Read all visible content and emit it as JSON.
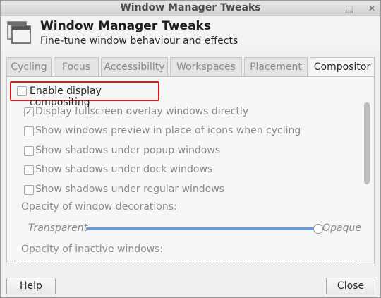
{
  "window": {
    "title": "Window Manager Tweaks",
    "controls": [
      "⬚",
      "✕"
    ]
  },
  "header": {
    "icon": "window-manager-icon",
    "title": "Window Manager Tweaks",
    "subtitle": "Fine-tune window behaviour and effects"
  },
  "tabs": [
    {
      "label": "Cycling",
      "active": false
    },
    {
      "label": "Focus",
      "active": false
    },
    {
      "label": "Accessibility",
      "active": false
    },
    {
      "label": "Workspaces",
      "active": false
    },
    {
      "label": "Placement",
      "active": false
    },
    {
      "label": "Compositor",
      "active": true
    }
  ],
  "compositor": {
    "enable_label": "Enable display compositing",
    "enable_checked": false,
    "options": [
      {
        "label": "Display fullscreen overlay windows directly",
        "checked": true
      },
      {
        "label": "Show windows preview in place of icons when cycling",
        "checked": false
      },
      {
        "label": "Show shadows under popup windows",
        "checked": false
      },
      {
        "label": "Show shadows under dock windows",
        "checked": false
      },
      {
        "label": "Show shadows under regular windows",
        "checked": false
      }
    ],
    "decorations_label": "Opacity of window decorations:",
    "slider_left": "Transparent",
    "slider_right": "Opaque",
    "decorations_opacity": 1.0,
    "inactive_label": "Opacity of inactive windows:"
  },
  "buttons": {
    "help": "Help",
    "close": "Close"
  },
  "colors": {
    "highlight_border": "#d61c1c",
    "slider_fill": "#6b9bd4"
  }
}
